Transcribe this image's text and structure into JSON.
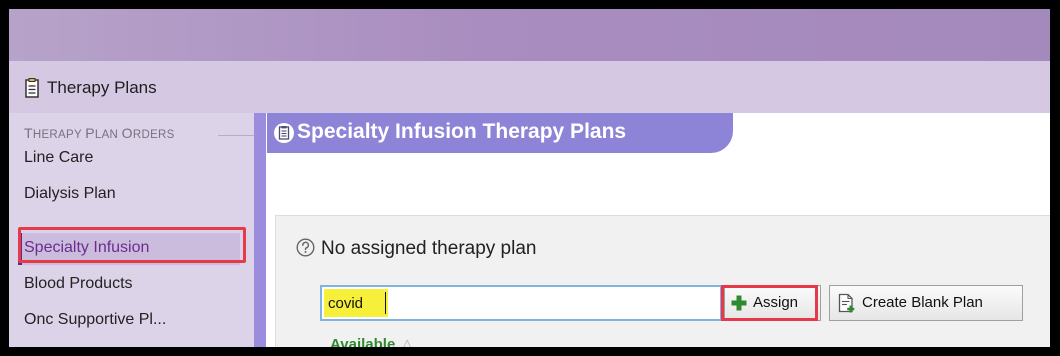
{
  "window": {
    "title": "Therapy Plans"
  },
  "sidebar": {
    "section_label_initial_1": "T",
    "section_label_rest_1": "HERAPY ",
    "section_label_initial_2": "P",
    "section_label_rest_2": "LAN ",
    "section_label_initial_3": "O",
    "section_label_rest_3": "RDERS",
    "items": [
      {
        "label": "Line Care"
      },
      {
        "label": "Dialysis Plan"
      },
      {
        "label": "Specialty Infusion"
      },
      {
        "label": "Blood Products"
      },
      {
        "label": "Onc Supportive Pl..."
      }
    ],
    "active_index": 2
  },
  "main": {
    "header_title": "Specialty Infusion Therapy Plans",
    "status_text": "No assigned therapy plan",
    "search": {
      "value": "covid"
    },
    "assign_label": "Assign",
    "create_blank_label": "Create Blank Plan",
    "available_label": "Available"
  },
  "colors": {
    "accent": "#8d84d8",
    "active_text": "#6b2d8f",
    "highlight": "#f6f03a",
    "annotation_red": "#e8394a",
    "plus_green": "#2e8a2e"
  }
}
